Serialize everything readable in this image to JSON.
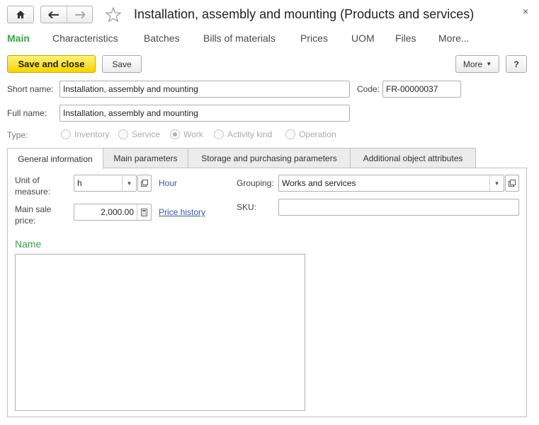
{
  "window": {
    "title": "Installation, assembly and mounting (Products and services)",
    "close_glyph": "×"
  },
  "icons": {
    "home": "home-icon",
    "back": "arrow-left-icon",
    "forward": "arrow-right-icon",
    "favorite": "star-icon",
    "dropdown": "triangle-down-icon",
    "open": "open-window-icon",
    "calculator": "calculator-icon"
  },
  "nav": {
    "items": [
      "Main",
      "Characteristics",
      "Batches",
      "Bills of materials",
      "Prices",
      "UOM",
      "Files",
      "More..."
    ]
  },
  "toolbar": {
    "save_close_label": "Save and close",
    "save_label": "Save",
    "more_label": "More",
    "help_label": "?"
  },
  "form": {
    "short_name_label": "Short name:",
    "short_name_value": "Installation, assembly and mounting",
    "code_label": "Code:",
    "code_value": "FR-00000037",
    "full_name_label": "Full name:",
    "full_name_value": "Installation, assembly and mounting",
    "type_label": "Type:",
    "type_options": [
      "Inventory",
      "Service",
      "Work",
      "Activity kind",
      "Operation"
    ],
    "type_selected": "Work"
  },
  "tabs": [
    "General information",
    "Main parameters",
    "Storage and purchasing parameters",
    "Additional object attributes"
  ],
  "general": {
    "uom_label_1": "Unit of",
    "uom_label_2": "measure:",
    "uom_value": "h",
    "uom_name": "Hour",
    "grouping_label": "Grouping:",
    "grouping_value": "Works and services",
    "price_label_1": "Main sale",
    "price_label_2": "price:",
    "price_value": "2,000.00",
    "price_history_label": "Price history",
    "sku_label": "SKU:",
    "sku_value": "",
    "name_heading": "Name",
    "name_text": ""
  },
  "colors": {
    "accent_green": "#3ea04a",
    "primary_yellow": "#f5d400",
    "link_blue": "#3a5a9a"
  }
}
